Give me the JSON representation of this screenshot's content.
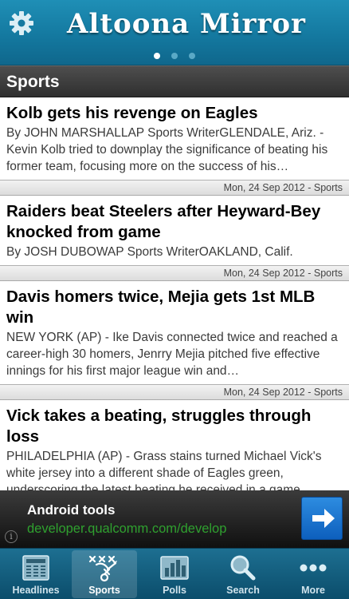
{
  "header": {
    "masthead": "Altoona Mirror",
    "settings_icon": "gear-icon",
    "page_dots": {
      "count": 3,
      "active": 0
    }
  },
  "section": {
    "title": "Sports"
  },
  "articles": [
    {
      "title": "Kolb gets his revenge on Eagles",
      "summary": "By JOHN MARSHALLAP Sports WriterGLENDALE, Ariz. - Kevin Kolb tried to downplay the significance of beating his former team, focusing more on the success of his…",
      "meta": "Mon, 24 Sep 2012 - Sports"
    },
    {
      "title": "Raiders beat Steelers after Heyward-Bey knocked from game",
      "summary": "By JOSH DUBOWAP Sports WriterOAKLAND, Calif.",
      "meta": "Mon, 24 Sep 2012 - Sports"
    },
    {
      "title": "Davis homers twice, Mejia gets 1st MLB win",
      "summary": "NEW YORK (AP) - Ike Davis connected twice and reached a career-high 30 homers, Jenrry Mejia pitched five effective innings for his first major league win and…",
      "meta": "Mon, 24 Sep 2012 - Sports"
    },
    {
      "title": "Vick takes a beating, struggles through loss",
      "summary": "PHILADELPHIA (AP) - Grass stains turned Michael Vick's white jersey into a different shade of Eagles green, underscoring the latest beating he received in a game.",
      "meta": ""
    }
  ],
  "ad": {
    "title": "Android tools",
    "url": "developer.qualcomm.com/develop",
    "info_icon": "info-icon",
    "arrow_icon": "arrow-right-icon"
  },
  "tabs": [
    {
      "label": "Headlines",
      "icon": "newspaper-icon",
      "active": false
    },
    {
      "label": "Sports",
      "icon": "playbook-icon",
      "active": true
    },
    {
      "label": "Polls",
      "icon": "bar-chart-icon",
      "active": false
    },
    {
      "label": "Search",
      "icon": "magnifier-icon",
      "active": false
    },
    {
      "label": "More",
      "icon": "more-dots-icon",
      "active": false
    }
  ],
  "colors": {
    "header_blue": "#1479a0",
    "section_bar": "#3a3a3a",
    "ad_url_green": "#2fa02f",
    "ad_button_blue": "#1a75d0"
  }
}
